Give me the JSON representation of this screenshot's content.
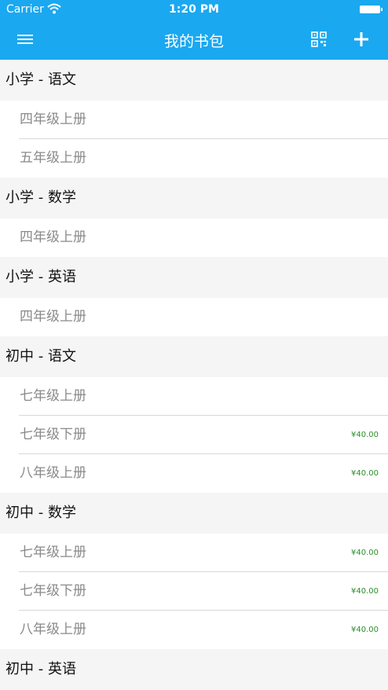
{
  "status_bar": {
    "carrier": "Carrier",
    "time": "1:20 PM"
  },
  "nav": {
    "title": "我的书包"
  },
  "sections": [
    {
      "header": "小学 - 语文",
      "rows": [
        {
          "label": "四年级上册",
          "price": ""
        },
        {
          "label": "五年级上册",
          "price": ""
        }
      ]
    },
    {
      "header": "小学 - 数学",
      "rows": [
        {
          "label": "四年级上册",
          "price": ""
        }
      ]
    },
    {
      "header": "小学 - 英语",
      "rows": [
        {
          "label": "四年级上册",
          "price": ""
        }
      ]
    },
    {
      "header": "初中 - 语文",
      "rows": [
        {
          "label": "七年级上册",
          "price": ""
        },
        {
          "label": "七年级下册",
          "price": "¥40.00"
        },
        {
          "label": "八年级上册",
          "price": "¥40.00"
        }
      ]
    },
    {
      "header": "初中 - 数学",
      "rows": [
        {
          "label": "七年级上册",
          "price": "¥40.00"
        },
        {
          "label": "七年级下册",
          "price": "¥40.00"
        },
        {
          "label": "八年级上册",
          "price": "¥40.00"
        }
      ]
    },
    {
      "header": "初中 - 英语",
      "rows": []
    }
  ]
}
